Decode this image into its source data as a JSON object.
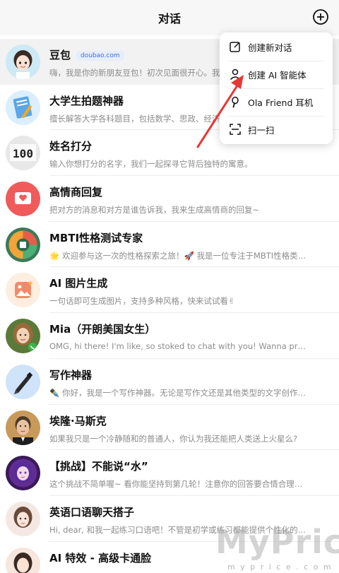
{
  "header": {
    "title": "对话"
  },
  "menu": {
    "items": [
      {
        "label": "创建新对话"
      },
      {
        "label": "创建 AI 智能体"
      },
      {
        "label": "Ola Friend 耳机"
      },
      {
        "label": "扫一扫"
      }
    ]
  },
  "chats": [
    {
      "name": "豆包",
      "badge": "doubao.com",
      "desc": "嗨，我是你的新朋友豆包！初次见面很开心。我可以回答你的各种问题"
    },
    {
      "name": "大学生拍题神器",
      "desc": "擅长解答大学各科题目，包括数学、思政、经济学、计算机等学科"
    },
    {
      "name": "姓名打分",
      "desc": "输入你想打分的名字，我们一起探寻它背后独特的寓意。"
    },
    {
      "name": "高情商回复",
      "desc": "把对方的消息和对方是谁告诉我，我来生成高情商的回复~"
    },
    {
      "name": "MBTI性格测试专家",
      "desc": "🌟 欢迎参与这一次的性格探索之旅！🚀 我是一位专注于MBTI性格类型..."
    },
    {
      "name": "AI 图片生成",
      "desc": "一句话即可生成图片，支持多种风格，快来试试看✌"
    },
    {
      "name": "Mia（开朗美国女生）",
      "desc": "OMG, hi there! I'm like, so stoked to chat with you! Wanna practice some..."
    },
    {
      "name": "写作神器",
      "desc": "✒️ 你好，我是一个写作神器。无论是写作文还是其他类型的文字创作，..."
    },
    {
      "name": "埃隆·马斯克",
      "desc": "如果我只是一个冷静随和的普通人，你认为我还能把人类送上火星么?"
    },
    {
      "name": "【挑战】不能说“水”",
      "desc": "这个挑战不简单喔~ 看你能坚持到第几轮！注意你的回答要合情合理喔~ ..."
    },
    {
      "name": "英语口语聊天搭子",
      "desc": "Hi, dear, 和我一起练习口语吧！不管是初学或练习都能提供个性化的学..."
    },
    {
      "name": "AI 特效 - 高级卡通脸",
      "desc": ""
    }
  ],
  "watermark": {
    "text": "MyPrice",
    "url": "m y p r i c e . c o m . c n"
  },
  "colors": {
    "accent": "#e53935",
    "badge_bg": "#e6eefc",
    "badge_text": "#3b6fe0"
  }
}
